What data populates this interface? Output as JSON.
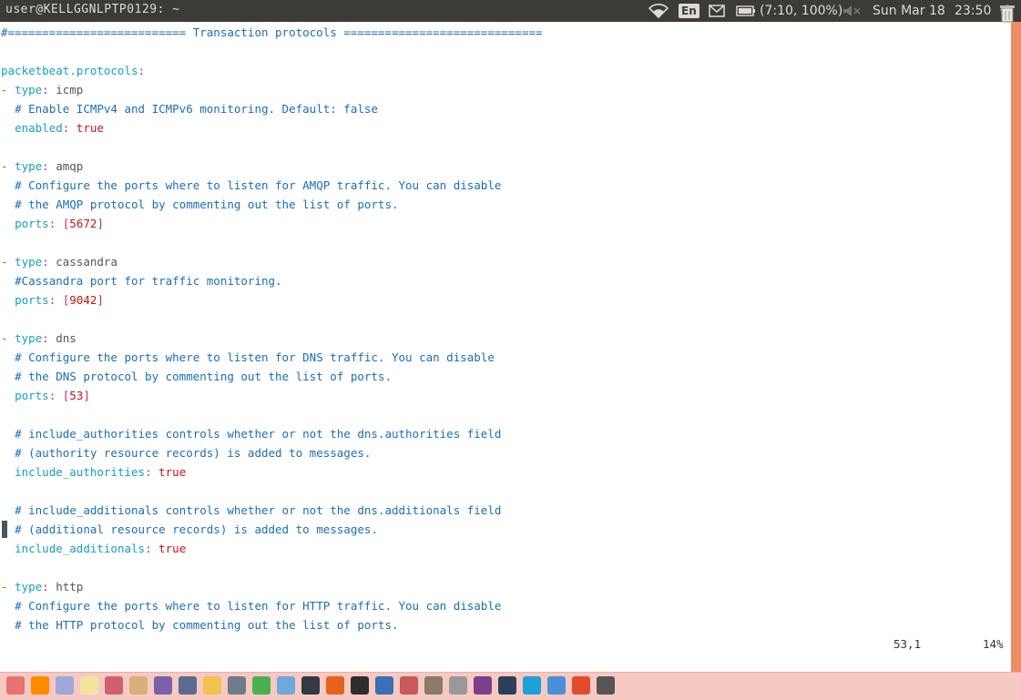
{
  "topbar": {
    "title": "user@KELLGGNLPTP0129: ~",
    "keyboard": "En",
    "battery": "(7:10, 100%)",
    "date": "Sun Mar 18",
    "time": "23:50"
  },
  "editor": {
    "lines": [
      {
        "type": "comment",
        "text": "#========================== Transaction protocols ============================="
      },
      {
        "type": "blank",
        "text": ""
      },
      {
        "type": "key",
        "key": "packetbeat.protocols",
        "text": "packetbeat.protocols"
      },
      {
        "type": "type",
        "value": "icmp"
      },
      {
        "type": "comment",
        "indent": "  ",
        "text": "# Enable ICMPv4 and ICMPv6 monitoring. Default: false"
      },
      {
        "type": "kv",
        "key": "enabled",
        "value": "true"
      },
      {
        "type": "blank",
        "text": ""
      },
      {
        "type": "type",
        "value": "amqp"
      },
      {
        "type": "comment",
        "indent": "  ",
        "text": "# Configure the ports where to listen for AMQP traffic. You can disable"
      },
      {
        "type": "comment",
        "indent": "  ",
        "text": "# the AMQP protocol by commenting out the list of ports."
      },
      {
        "type": "ports",
        "key": "ports",
        "value": "5672"
      },
      {
        "type": "blank",
        "text": ""
      },
      {
        "type": "type",
        "value": "cassandra"
      },
      {
        "type": "comment",
        "indent": "  ",
        "text": "#Cassandra port for traffic monitoring."
      },
      {
        "type": "ports",
        "key": "ports",
        "value": "9042"
      },
      {
        "type": "blank",
        "text": ""
      },
      {
        "type": "type",
        "value": "dns"
      },
      {
        "type": "comment",
        "indent": "  ",
        "text": "# Configure the ports where to listen for DNS traffic. You can disable"
      },
      {
        "type": "comment",
        "indent": "  ",
        "text": "# the DNS protocol by commenting out the list of ports."
      },
      {
        "type": "ports",
        "key": "ports",
        "value": "53"
      },
      {
        "type": "blank",
        "text": ""
      },
      {
        "type": "comment",
        "indent": "  ",
        "text": "# include_authorities controls whether or not the dns.authorities field"
      },
      {
        "type": "comment",
        "indent": "  ",
        "text": "# (authority resource records) is added to messages."
      },
      {
        "type": "kv",
        "key": "include_authorities",
        "value": "true"
      },
      {
        "type": "blank",
        "text": ""
      },
      {
        "type": "comment",
        "indent": "  ",
        "text": "# include_additionals controls whether or not the dns.additionals field"
      },
      {
        "type": "comment",
        "indent": "  ",
        "text": "# (additional resource records) is added to messages."
      },
      {
        "type": "kv",
        "key": "include_additionals",
        "value": "true"
      },
      {
        "type": "blank",
        "text": ""
      },
      {
        "type": "type",
        "value": "http"
      },
      {
        "type": "comment",
        "indent": "  ",
        "text": "# Configure the ports where to listen for HTTP traffic. You can disable"
      },
      {
        "type": "comment",
        "indent": "  ",
        "text": "# the HTTP protocol by commenting out the list of ports."
      }
    ],
    "type_keyword": "type",
    "status_position": "53,1",
    "status_percent": "14%"
  },
  "colors": {
    "topbar_bg": "#3c3b37",
    "comment": "#1a6fb5",
    "key": "#16a0c0",
    "bool": "#cc1010",
    "scrollbar": "#ef8c68",
    "dock_bg": "#f6c9c2"
  },
  "dock": {
    "icons": [
      "back-arrow-icon",
      "vlc-icon",
      "screenshot-icon",
      "text-editor-icon",
      "media-icon",
      "files-icon",
      "color-picker-icon",
      "system-monitor-icon",
      "user-icon",
      "remote-desktop-icon",
      "spreadsheet-icon",
      "virtualbox-icon",
      "ide-icon",
      "firefox-icon",
      "terminal-icon",
      "document-viewer-icon",
      "archive-icon",
      "gimp-icon",
      "calculator-icon",
      "slideshow-icon",
      "video-icon",
      "skype-icon",
      "chromium-icon",
      "app-launcher-icon",
      "settings-icon"
    ],
    "trash": "trash-icon"
  }
}
